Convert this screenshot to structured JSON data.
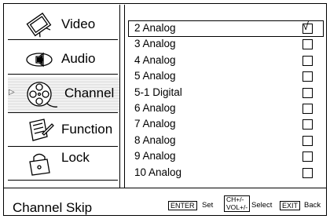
{
  "sidebar": {
    "items": [
      {
        "label": "Video",
        "icon": "video-tv-icon",
        "selected": false
      },
      {
        "label": "Audio",
        "icon": "audio-speaker-icon",
        "selected": false
      },
      {
        "label": "Channel",
        "icon": "channel-film-reel-icon",
        "selected": true
      },
      {
        "label": "Function",
        "icon": "function-notepad-icon",
        "selected": false
      },
      {
        "label": "Lock",
        "icon": "lock-padlock-icon",
        "selected": false
      }
    ]
  },
  "channels": [
    {
      "name": "2 Analog",
      "checked": true
    },
    {
      "name": "3 Analog",
      "checked": false
    },
    {
      "name": "4 Analog",
      "checked": false
    },
    {
      "name": "5 Analog",
      "checked": false
    },
    {
      "name": "5-1 Digital",
      "checked": false
    },
    {
      "name": "6 Analog",
      "checked": false
    },
    {
      "name": "7 Analog",
      "checked": false
    },
    {
      "name": "8 Analog",
      "checked": false
    },
    {
      "name": "9 Analog",
      "checked": false
    },
    {
      "name": "10 Analog",
      "checked": false
    }
  ],
  "checkmark": "√",
  "footer": {
    "title": "Channel Skip",
    "enter_key": "ENTER",
    "enter_action": "Set",
    "ch_key_line1": "CH+/-",
    "ch_key_line2": "VOL+/-",
    "ch_action": "Select",
    "exit_key": "EXIT",
    "exit_action": "Back"
  }
}
